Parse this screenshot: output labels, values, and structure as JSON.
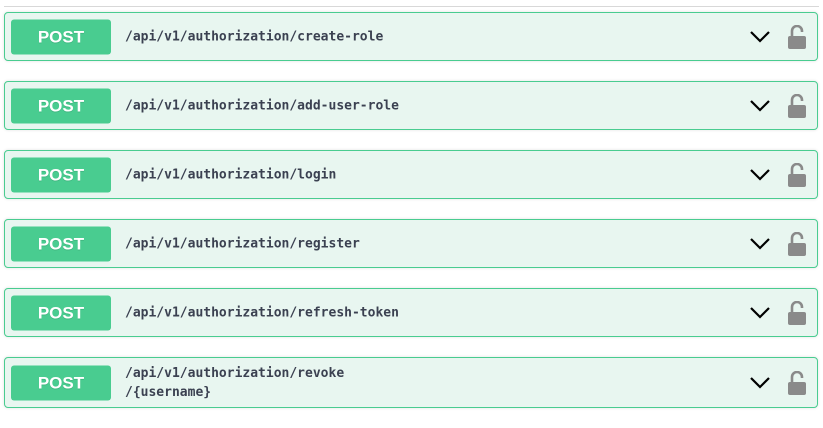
{
  "operations": [
    {
      "method": "POST",
      "path": "/api/v1/authorization/create-role"
    },
    {
      "method": "POST",
      "path": "/api/v1/authorization/add-user-role"
    },
    {
      "method": "POST",
      "path": "/api/v1/authorization/login"
    },
    {
      "method": "POST",
      "path": "/api/v1/authorization/register"
    },
    {
      "method": "POST",
      "path": "/api/v1/authorization/refresh-token"
    },
    {
      "method": "POST",
      "path": "/api/v1/authorization/revoke\n/{username}"
    }
  ],
  "icons": {
    "expand": "chevron-down-icon",
    "auth": "unlocked-padlock-icon"
  },
  "colors": {
    "post_accent": "#49cc90",
    "post_background": "#e8f6f0",
    "path_text": "#3b4151",
    "icon_gray": "#8a8a8a"
  }
}
